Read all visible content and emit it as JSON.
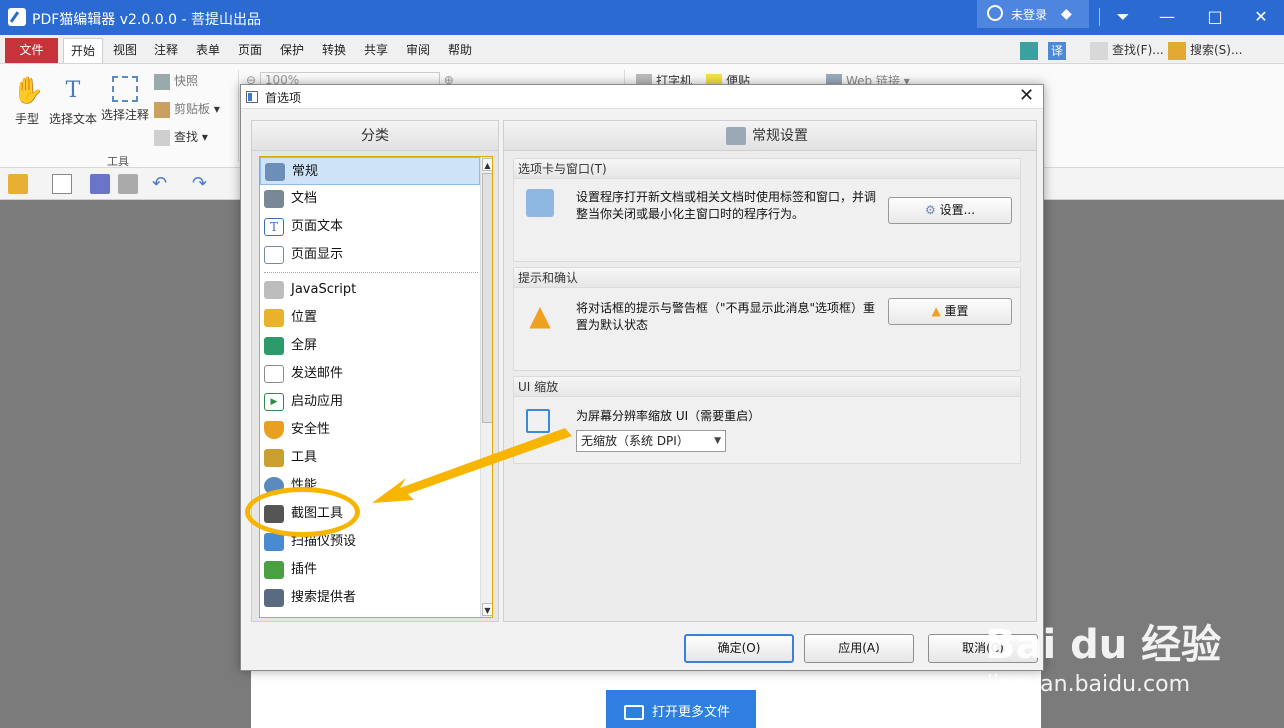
{
  "titlebar": {
    "title": "PDF猫编辑器 v2.0.0.0 - 菩提山出品",
    "user_label": "未登录",
    "minimize": "—",
    "maximize": "□",
    "close": "✕",
    "menu_glyph": "⏷"
  },
  "menubar": {
    "file": "文件",
    "tabs": [
      "开始",
      "视图",
      "注释",
      "表单",
      "页面",
      "保护",
      "转换",
      "共享",
      "审阅",
      "帮助"
    ],
    "search_label": "查找(F)...",
    "search2_label": "搜索(S)..."
  },
  "ribbon": {
    "hand": "手型",
    "select_text": "选择文本",
    "select_annot": "选择注释",
    "snapshot": "快照",
    "clipboard": "剪贴板",
    "find": "查找",
    "group_tools": "工具",
    "zoom": "100%",
    "typewriter": "打字机",
    "note": "便贴",
    "weblink": "Web 链接"
  },
  "dialog": {
    "title": "首选项",
    "close": "✕",
    "left_header": "分类",
    "right_header": "常规设置",
    "categories": [
      {
        "label": "常规",
        "icon": "general-icon",
        "color": "#6c8fb8"
      },
      {
        "label": "文档",
        "icon": "document-icon",
        "color": "#7a8797"
      },
      {
        "label": "页面文本",
        "icon": "text-icon",
        "color": "#3b6fb6"
      },
      {
        "label": "页面显示",
        "icon": "page-display-icon",
        "color": "#7a8797"
      },
      {
        "label": "JavaScript",
        "icon": "javascript-icon",
        "color": "#8b8b8b"
      },
      {
        "label": "位置",
        "icon": "folder-icon",
        "color": "#e8b32a"
      },
      {
        "label": "全屏",
        "icon": "fullscreen-icon",
        "color": "#2c9a6a"
      },
      {
        "label": "发送邮件",
        "icon": "mail-icon",
        "color": "#8a8a8a"
      },
      {
        "label": "启动应用",
        "icon": "launch-icon",
        "color": "#2f8a4a"
      },
      {
        "label": "安全性",
        "icon": "shield-icon",
        "color": "#e8a020"
      },
      {
        "label": "工具",
        "icon": "tools-icon",
        "color": "#c9a030"
      },
      {
        "label": "性能",
        "icon": "gauge-icon",
        "color": "#5a8ac0"
      },
      {
        "label": "截图工具",
        "icon": "camera-icon",
        "color": "#555555"
      },
      {
        "label": "扫描仪预设",
        "icon": "scanner-icon",
        "color": "#4a8ad0"
      },
      {
        "label": "插件",
        "icon": "puzzle-icon",
        "color": "#4aa040"
      },
      {
        "label": "搜索提供者",
        "icon": "binoculars-icon",
        "color": "#5a6a80"
      }
    ],
    "sections": {
      "tabs": {
        "header": "选项卡与窗口(T)",
        "desc_line1": "设置程序打开新文档或相关文档时使用标签和窗口，并调",
        "desc_line2": "整当你关闭或最小化主窗口时的程序行为。",
        "button": "设置..."
      },
      "prompts": {
        "header": "提示和确认",
        "desc_line1": "将对话框的提示与警告框（\"不再显示此消息\"选项框）重",
        "desc_line2": "置为默认状态",
        "button": "重置"
      },
      "ui": {
        "header": "UI 缩放",
        "desc": "为屏幕分辨率缩放 UI（需要重启）",
        "select_value": "无缩放（系统 DPI）"
      }
    },
    "ok": "确定(O)",
    "apply": "应用(A)",
    "cancel": "取消(C)"
  },
  "workspace": {
    "open_more": "打开更多文件"
  },
  "watermark": {
    "brand": "Bai du 经验",
    "url": "jingyan.baidu.com"
  },
  "colors": {
    "titlebar": "#2b6bd1",
    "file_tab": "#c8323a",
    "highlight": "#f7b500",
    "selection": "#cfe3f8"
  }
}
